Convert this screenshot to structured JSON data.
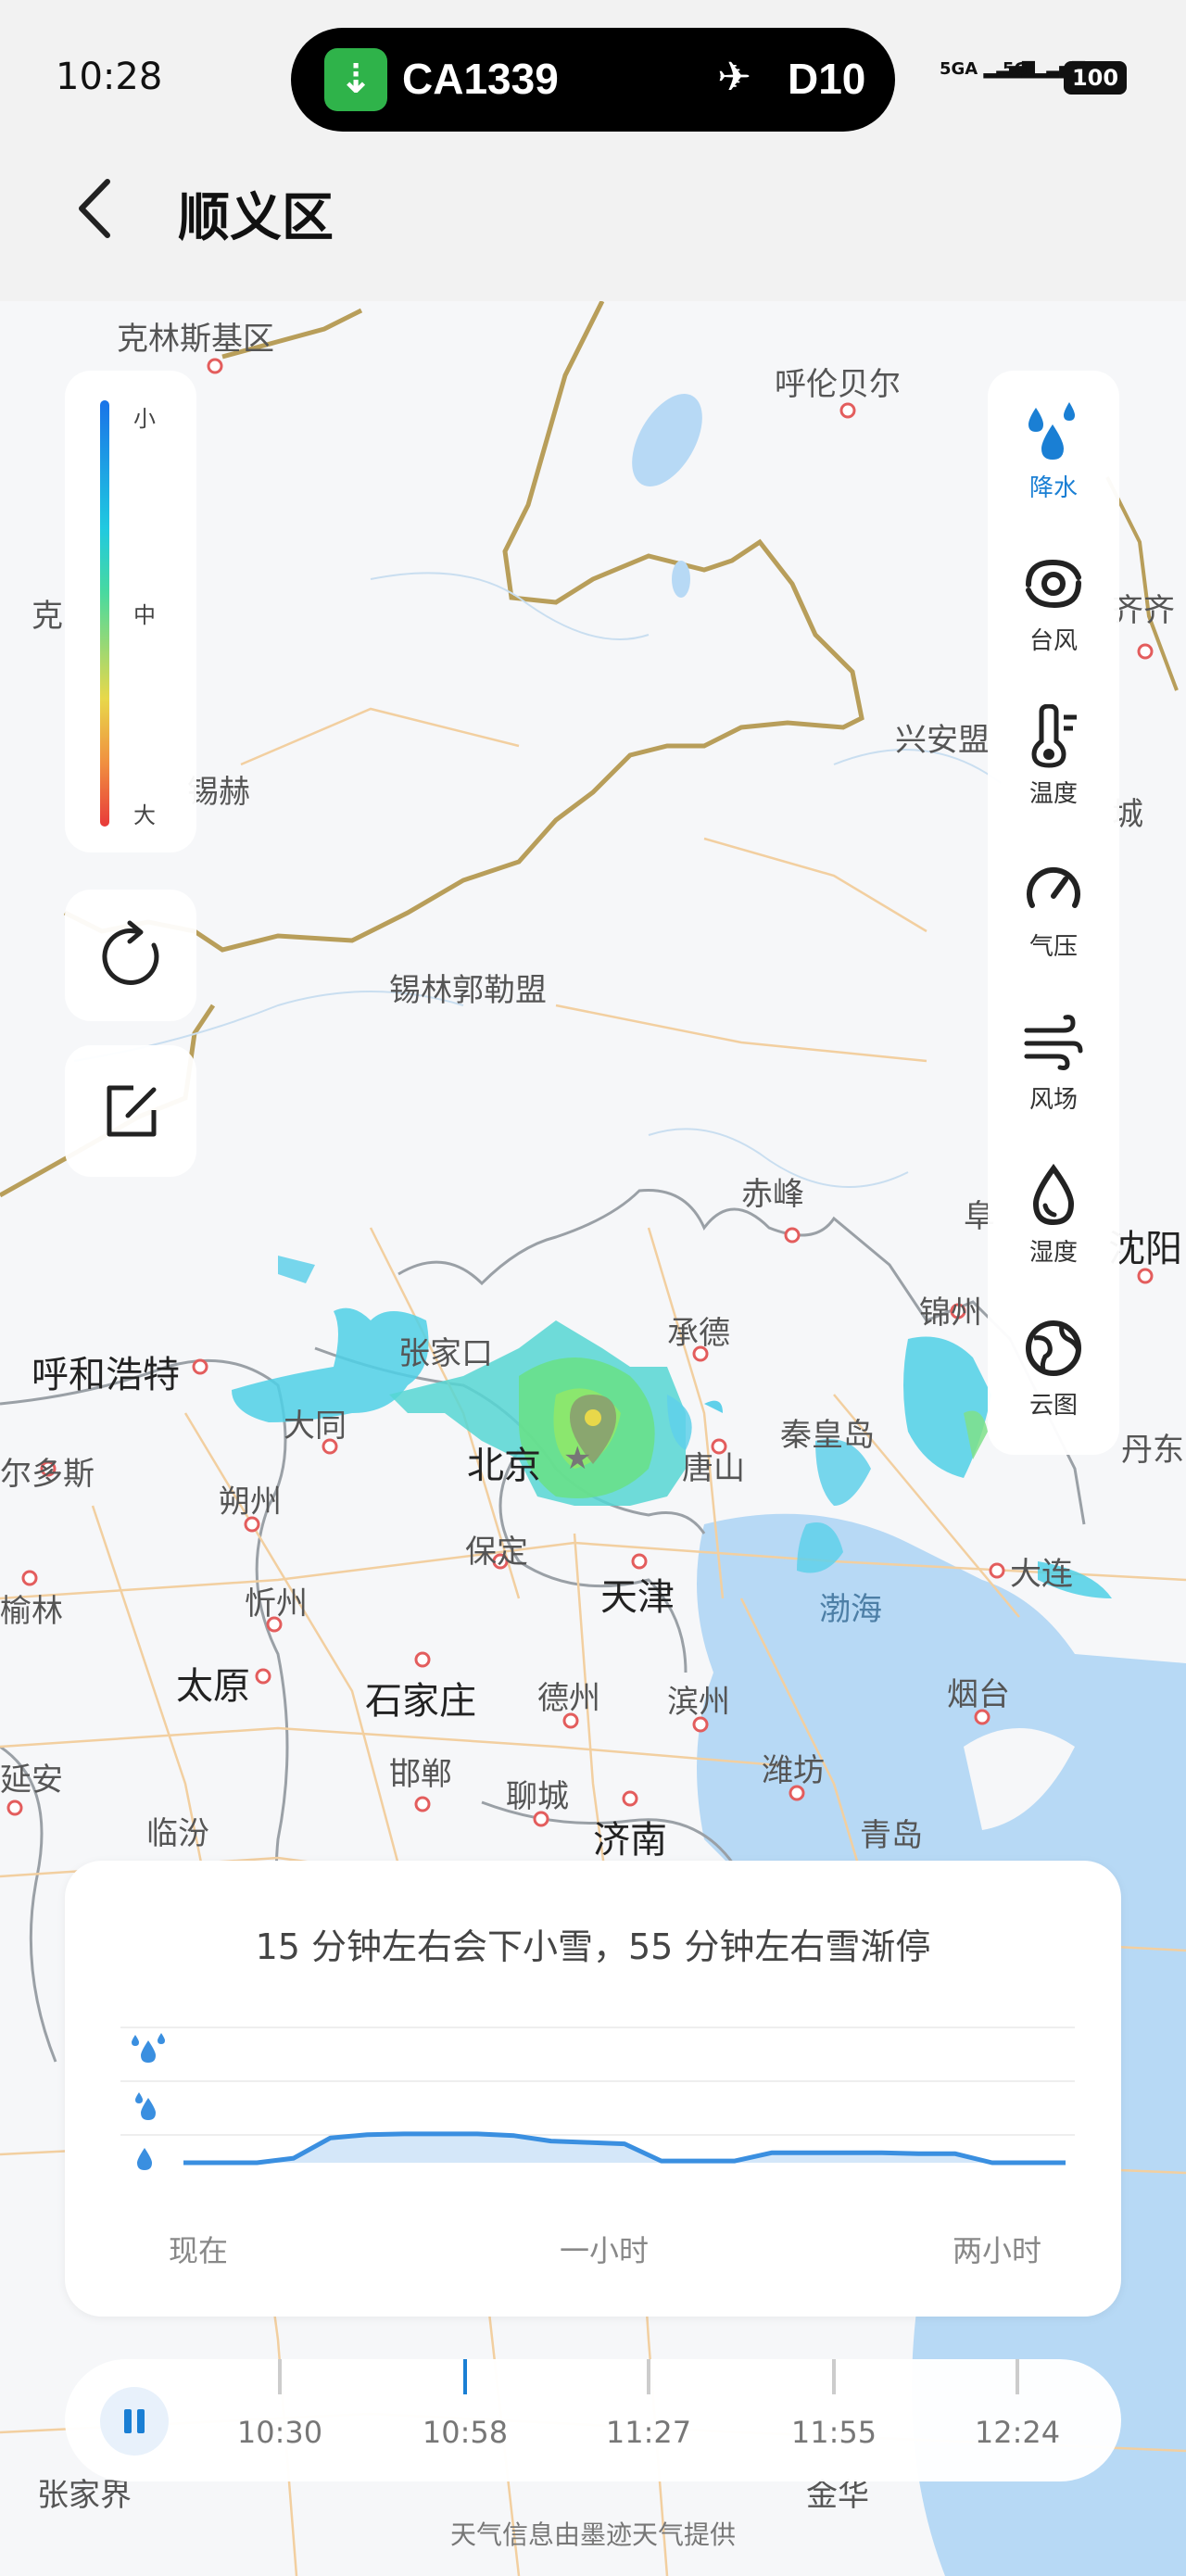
{
  "status_bar": {
    "time": "10:28",
    "flight": "CA1339",
    "gate": "D10",
    "sim1": "5GA",
    "sim2": "5G",
    "battery": "100"
  },
  "header": {
    "title": "顺义区"
  },
  "legend": {
    "top": "小",
    "middle": "中",
    "bottom": "大"
  },
  "layers": [
    {
      "label": "降水",
      "icon": "precipitation-icon",
      "active": true
    },
    {
      "label": "台风",
      "icon": "typhoon-icon"
    },
    {
      "label": "温度",
      "icon": "thermometer-icon"
    },
    {
      "label": "气压",
      "icon": "pressure-gauge-icon"
    },
    {
      "label": "风场",
      "icon": "wind-icon"
    },
    {
      "label": "湿度",
      "icon": "humidity-drop-icon"
    },
    {
      "label": "云图",
      "icon": "cloud-globe-icon"
    }
  ],
  "map_labels": {
    "l1": "克林斯基区",
    "l2": "呼伦贝尔",
    "l3": "克",
    "l4": "齐齐",
    "l5": "兴安盟",
    "l6": "锡赫",
    "l7": "城",
    "l8": "锡林郭勒盟",
    "l9": "赤峰",
    "l10": "阜",
    "l11": "沈阳",
    "l12": "锦州",
    "l13": "呼和浩特",
    "l14": "张家口",
    "l15": "承德",
    "l16": "大同",
    "l17": "北京",
    "l18": "唐山",
    "l19": "秦皇岛",
    "l20": "丹东",
    "l21": "尔多斯",
    "l22": "朔州",
    "l23": "保定",
    "l24": "天津",
    "l25": "渤海",
    "l26": "大连",
    "l27": "榆林",
    "l28": "忻州",
    "l29": "太原",
    "l30": "石家庄",
    "l31": "德州",
    "l32": "滨州",
    "l33": "烟台",
    "l34": "延安",
    "l35": "邯郸",
    "l36": "聊城",
    "l37": "潍坊",
    "l38": "临汾",
    "l39": "济南",
    "l40": "青岛",
    "l41": "张家界",
    "l42": "金华"
  },
  "forecast": {
    "summary": "15 分钟左右会下小雪，55 分钟左右雪渐停",
    "axis": [
      "现在",
      "一小时",
      "两小时"
    ],
    "intensity_levels": [
      "小",
      "中",
      "大"
    ]
  },
  "timeline": {
    "ticks": [
      "10:30",
      "10:58",
      "11:27",
      "11:55",
      "12:24"
    ],
    "active_index": 1
  },
  "credit": "天气信息由墨迹天气提供",
  "chart_data": {
    "type": "area",
    "title": "",
    "xlabel": "",
    "ylabel": "",
    "x_ticks": [
      "现在",
      "一小时",
      "两小时"
    ],
    "x": [
      0,
      5,
      10,
      15,
      20,
      25,
      30,
      35,
      40,
      45,
      50,
      55,
      60,
      65,
      70,
      75,
      80,
      85,
      90,
      95,
      100,
      105,
      110,
      115,
      120
    ],
    "values": [
      0,
      0,
      0,
      0.1,
      0.55,
      0.62,
      0.64,
      0.64,
      0.64,
      0.6,
      0.48,
      0.45,
      0.42,
      0.04,
      0.04,
      0.04,
      0.22,
      0.22,
      0.22,
      0.22,
      0.2,
      0.2,
      0.0,
      0.0,
      0.0
    ],
    "ylim": [
      0,
      3
    ],
    "color": "#3a8fe0"
  }
}
